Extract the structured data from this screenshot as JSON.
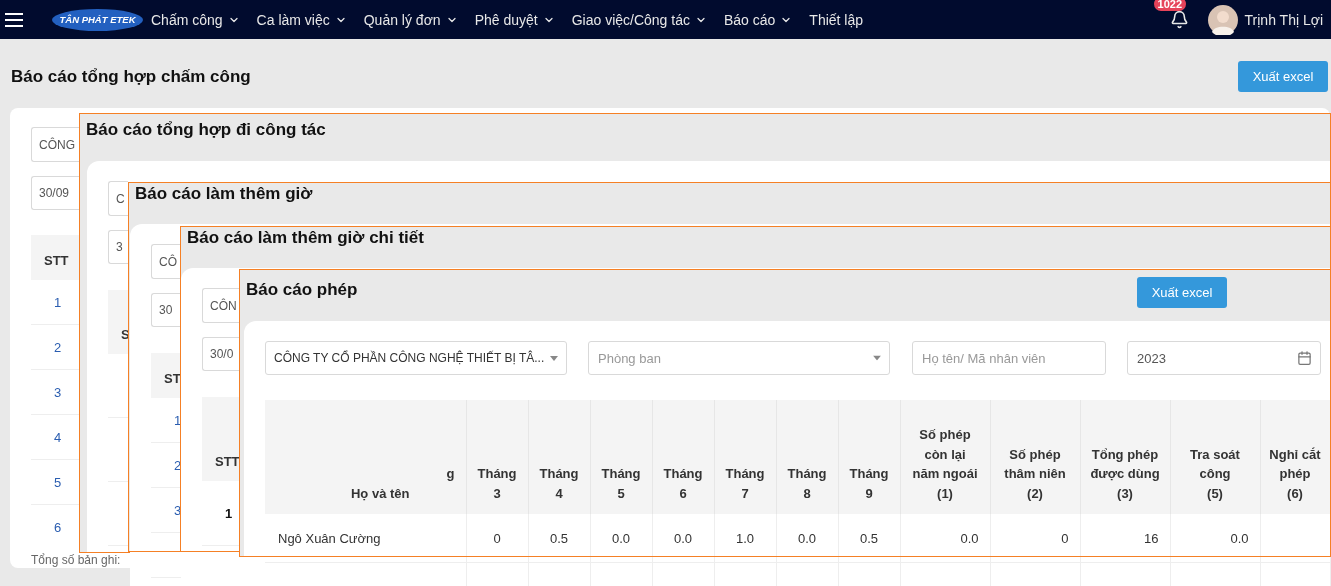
{
  "nav": {
    "brand": "TÂN PHÁT ETEK",
    "items": [
      {
        "label": "Chấm công",
        "has_menu": true
      },
      {
        "label": "Ca làm việc",
        "has_menu": true
      },
      {
        "label": "Quản lý đơn",
        "has_menu": true
      },
      {
        "label": "Phê duyệt",
        "has_menu": true
      },
      {
        "label": "Giao việc/Công tác",
        "has_menu": true
      },
      {
        "label": "Báo cáo",
        "has_menu": true
      },
      {
        "label": "Thiết lập",
        "has_menu": false
      }
    ],
    "notification_count": "1022",
    "user_name": "Trịnh Thị Lợi"
  },
  "page": {
    "title": "Báo cáo tổng hợp chấm công",
    "export_button": "Xuất excel",
    "company_select": "CÔNG",
    "date_field": "30/09",
    "table": {
      "header": "STT",
      "rows": [
        "1",
        "2",
        "3",
        "4",
        "5",
        "6"
      ]
    },
    "footer": "Tổng số bản ghi:"
  },
  "windows": [
    {
      "title": "Báo cáo tổng hợp đi công tác",
      "company_select": "C",
      "date_field": "3",
      "table": {
        "header": "S"
      }
    },
    {
      "title": "Báo cáo làm thêm giờ",
      "company_select": "CÔ",
      "date_field": "30",
      "table": {
        "header": "ST",
        "rows": [
          "1",
          "2",
          "3"
        ]
      }
    },
    {
      "title": "Báo cáo làm thêm giờ chi tiết",
      "company_select": "CÔN",
      "date_field": "30/0",
      "table": {
        "header": "STT",
        "rows": [
          "1"
        ],
        "bold_rows": true
      }
    }
  ],
  "leave_report": {
    "title": "Báo cáo phép",
    "export_button": "Xuất excel",
    "company_select": "CÔNG TY CỔ PHẦN CÔNG NGHỆ THIẾT BỊ TÂ...",
    "department_select": {
      "placeholder": "Phòng ban"
    },
    "search_field": {
      "placeholder": "Họ tên/ Mã nhân viên"
    },
    "year_field": "2023",
    "table": {
      "columns": [
        {
          "kind": "name",
          "label": "Họ và tên",
          "fragment": "g"
        },
        {
          "kind": "month",
          "label": "Tháng\n3"
        },
        {
          "kind": "month",
          "label": "Tháng\n4"
        },
        {
          "kind": "month",
          "label": "Tháng\n5"
        },
        {
          "kind": "month",
          "label": "Tháng\n6"
        },
        {
          "kind": "month",
          "label": "Tháng\n7"
        },
        {
          "kind": "month",
          "label": "Tháng\n8"
        },
        {
          "kind": "month",
          "label": "Tháng\n9"
        },
        {
          "kind": "count",
          "label": "Số phép\ncòn lại\nnăm ngoái\n(1)"
        },
        {
          "kind": "count",
          "label": "Số phép\nthâm niên\n(2)"
        },
        {
          "kind": "count",
          "label": "Tổng phép\nđược dùng\n(3)"
        },
        {
          "kind": "count",
          "label": "Tra soát\ncông\n(5)"
        },
        {
          "kind": "count",
          "label": "Nghỉ cắt\nphép\n(6)"
        }
      ],
      "rows": [
        {
          "cells": [
            "Ngô Xuân Cường",
            "0",
            "0.5",
            "0.0",
            "0.0",
            "1.0",
            "0.0",
            "0.5",
            "0.0",
            "0",
            "16",
            "0.0"
          ]
        }
      ]
    }
  }
}
